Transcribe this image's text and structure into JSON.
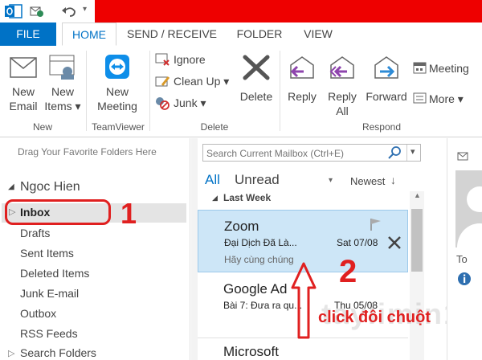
{
  "tabs": [
    "FILE",
    "HOME",
    "SEND / RECEIVE",
    "FOLDER",
    "VIEW"
  ],
  "ribbon": {
    "new_email": [
      "New",
      "Email"
    ],
    "new_items": [
      "New",
      "Items ▾"
    ],
    "new_meeting": [
      "New",
      "Meeting"
    ],
    "ignore": "Ignore",
    "cleanup": "Clean Up ▾",
    "junk": "Junk ▾",
    "delete": "Delete",
    "reply": "Reply",
    "reply_all": [
      "Reply",
      "All"
    ],
    "forward": "Forward",
    "meeting": "Meeting",
    "more": "More ▾",
    "groups": [
      "New",
      "TeamViewer",
      "Delete",
      "Respond"
    ]
  },
  "left": {
    "favorites_hint": "Drag Your Favorite Folders Here",
    "account": "Ngoc Hien",
    "folders": [
      "Inbox",
      "Drafts",
      "Sent Items",
      "Deleted Items",
      "Junk E-mail",
      "Outbox",
      "RSS Feeds",
      "Search Folders"
    ]
  },
  "search": {
    "placeholder": "Search Current Mailbox (Ctrl+E)"
  },
  "filters": {
    "all": "All",
    "unread": "Unread",
    "sort": "Newest"
  },
  "group_header": "Last Week",
  "messages": [
    {
      "sender": "Zoom",
      "subject": "Đại Dịch Đã Là...",
      "date": "Sat 07/08",
      "preview": "Hãy cùng chúng"
    },
    {
      "sender": "Google Ad",
      "subject": "Bài 7: Đưa ra qu...",
      "date": "Thu 05/08"
    },
    {
      "sender": "Microsoft"
    }
  ],
  "annotations": {
    "one": "1",
    "two": "2",
    "caption": "click đôi chuột"
  },
  "watermark": "taylimin1",
  "right": {
    "to": "To"
  },
  "colors": {
    "accent": "#0072c6",
    "title_red": "#ee0000",
    "annot_red": "#e02020",
    "selected": "#cde6f7"
  }
}
